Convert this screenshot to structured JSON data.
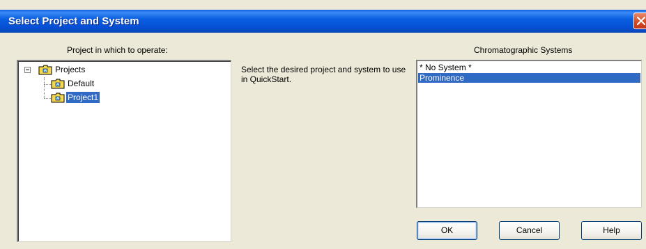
{
  "window": {
    "title": "Select Project and System"
  },
  "project_panel": {
    "label": "Project in which to operate:",
    "tree": {
      "root": "Projects",
      "children": [
        "Default",
        "Project1"
      ],
      "selected": "Project1"
    }
  },
  "instructions": "Select the desired project and system to use in QuickStart.",
  "systems_panel": {
    "label": "Chromatographic Systems",
    "items": [
      "* No System *",
      "Prominence"
    ],
    "selected": "Prominence"
  },
  "buttons": {
    "ok": "OK",
    "cancel": "Cancel",
    "help": "Help"
  },
  "colors": {
    "titlebar": "#0a5fe0",
    "selection": "#316ac5",
    "dialog_bg": "#ece9d8",
    "close_button": "#d3481f"
  },
  "icons": {
    "tree_root": "folder-icon",
    "tree_child": "folder-icon",
    "expander": "minus-expander-icon",
    "close": "close-icon"
  }
}
